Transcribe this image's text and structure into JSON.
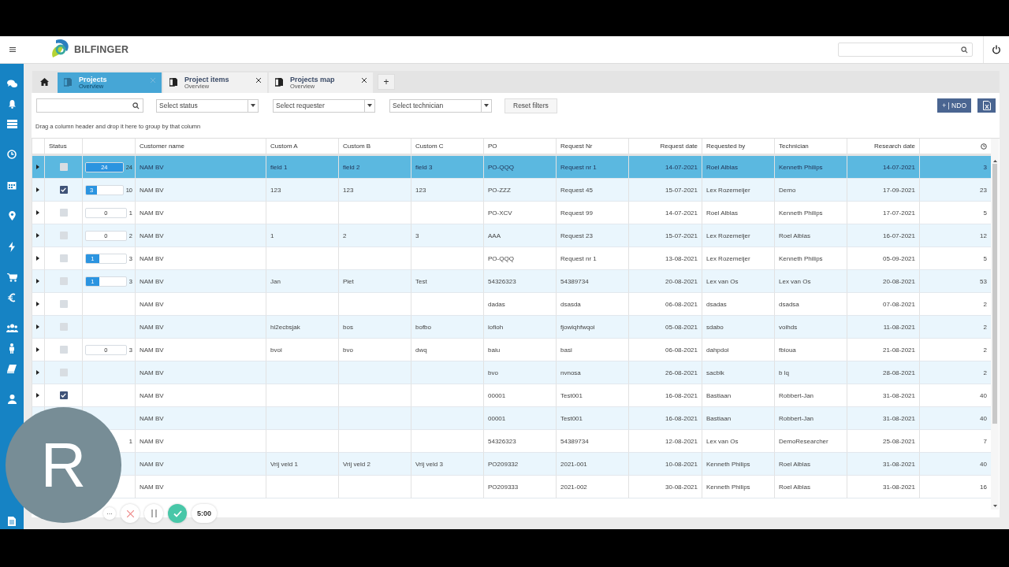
{
  "header": {
    "logo_text": "BILFINGER"
  },
  "tabs": [
    {
      "title": "Projects",
      "subtitle": "Overview",
      "selected": true
    },
    {
      "title": "Project items",
      "subtitle": "Overview",
      "selected": false
    },
    {
      "title": "Projects map",
      "subtitle": "Overview",
      "selected": false
    }
  ],
  "tab_add": "+",
  "filters": {
    "dropdowns": [
      {
        "placeholder": "Select status"
      },
      {
        "placeholder": "Select requester"
      },
      {
        "placeholder": "Select technician"
      }
    ],
    "reset": "Reset filters",
    "new_button": "+ | NDO"
  },
  "group_hint": "Drag a column header and drop it here to group by that column",
  "table": {
    "columns": [
      null,
      "Status",
      null,
      "Customer name",
      "Custom A",
      "Custom B",
      "Custom C",
      "PO",
      "Request Nr",
      "Request date",
      "Requested by",
      "Technician",
      "Research date",
      null
    ],
    "rows": [
      {
        "selected": true,
        "checked": false,
        "progress": {
          "value": "24",
          "total": "24",
          "level": 1
        },
        "cells": [
          null,
          null,
          null,
          "NAM BV",
          "field 1",
          "field 2",
          "field 3",
          "PO-QQQ",
          "Request nr 1",
          "14-07-2021",
          "Roel Alblas",
          "Kenneth Philips",
          "14-07-2021",
          "3"
        ]
      },
      {
        "selected": false,
        "checked": true,
        "progress": {
          "value": "3",
          "total": "10",
          "level": 0.3
        },
        "cells": [
          null,
          null,
          null,
          "NAM BV",
          "123",
          "123",
          "123",
          "PO-ZZZ",
          "Request 45",
          "15-07-2021",
          "Lex Rozemeijer",
          "Demo",
          "17-09-2021",
          "23"
        ]
      },
      {
        "selected": false,
        "checked": false,
        "progress": {
          "value": "0",
          "total": "1",
          "level": 0
        },
        "cells": [
          null,
          null,
          null,
          "NAM BV",
          null,
          null,
          null,
          "PO-XCV",
          "Request 99",
          "14-07-2021",
          "Roel Alblas",
          "Kenneth Philips",
          "17-07-2021",
          "5"
        ]
      },
      {
        "selected": false,
        "checked": false,
        "progress": {
          "value": "0",
          "total": "2",
          "level": 0
        },
        "cells": [
          null,
          null,
          null,
          "NAM BV",
          "1",
          "2",
          "3",
          "AAA",
          "Request 23",
          "15-07-2021",
          "Lex Rozemeijer",
          "Roel Alblas",
          "16-07-2021",
          "12"
        ]
      },
      {
        "selected": false,
        "checked": false,
        "progress": {
          "value": "1",
          "total": "3",
          "level": 0.33
        },
        "cells": [
          null,
          null,
          null,
          "NAM BV",
          null,
          null,
          null,
          "PO-QQQ",
          "Request nr 1",
          "13-08-2021",
          "Lex Rozemeijer",
          "Kenneth Philips",
          "05-09-2021",
          "5"
        ]
      },
      {
        "selected": false,
        "checked": false,
        "progress": {
          "value": "1",
          "total": "3",
          "level": 0.33
        },
        "cells": [
          null,
          null,
          null,
          "NAM BV",
          "Jan",
          "Piet",
          "Test",
          "54326323",
          "54389734",
          "20-08-2021",
          "Lex van Os",
          "Lex van Os",
          "20-08-2021",
          "53"
        ]
      },
      {
        "selected": false,
        "checked": false,
        "cells": [
          null,
          null,
          null,
          "NAM BV",
          null,
          null,
          null,
          "dadas",
          "dsasda",
          "06-08-2021",
          "dsadas",
          "dsadsa",
          "07-08-2021",
          "2"
        ]
      },
      {
        "selected": false,
        "checked": false,
        "cells": [
          null,
          null,
          null,
          "NAM BV",
          "hi2ecbsjak",
          "bos",
          "bofbo",
          "iofioh",
          "fjowiqhfwqoi",
          "05-08-2021",
          "sdabo",
          "voihds",
          "11-08-2021",
          "2"
        ]
      },
      {
        "selected": false,
        "checked": false,
        "progress": {
          "value": "0",
          "total": "3",
          "level": 0
        },
        "cells": [
          null,
          null,
          null,
          "NAM BV",
          "bvoi",
          "bvo",
          "dwq",
          "baiu",
          "basi",
          "06-08-2021",
          "dahpdoi",
          "fbioua",
          "21-08-2021",
          "2"
        ]
      },
      {
        "selected": false,
        "checked": false,
        "cells": [
          null,
          null,
          null,
          "NAM BV",
          null,
          null,
          null,
          "bvo",
          "nvnosa",
          "26-08-2021",
          "sacblk",
          "b lq",
          "28-08-2021",
          "2"
        ]
      },
      {
        "selected": false,
        "checked": true,
        "cells": [
          null,
          null,
          null,
          "NAM BV",
          null,
          null,
          null,
          "00001",
          "Test001",
          "16-08-2021",
          "Bastiaan",
          "Robbert-Jan",
          "31-08-2021",
          "40"
        ]
      },
      {
        "selected": false,
        "cells": [
          null,
          null,
          null,
          "NAM BV",
          null,
          null,
          null,
          "00001",
          "Test001",
          "16-08-2021",
          "Bastiaan",
          "Robbert-Jan",
          "31-08-2021",
          "40"
        ]
      },
      {
        "selected": false,
        "progress": {
          "total": "1"
        },
        "cells": [
          null,
          null,
          null,
          "NAM BV",
          null,
          null,
          null,
          "54326323",
          "54389734",
          "12-08-2021",
          "Lex van Os",
          "DemoResearcher",
          "25-08-2021",
          "7"
        ]
      },
      {
        "selected": false,
        "cells": [
          null,
          null,
          null,
          "NAM BV",
          "Vrij veld 1",
          "Vrij veld 2",
          "Vrij veld 3",
          "PO209332",
          "2021-001",
          "10-08-2021",
          "Kenneth Philips",
          "Roel Alblas",
          "31-08-2021",
          "40"
        ]
      },
      {
        "selected": false,
        "cells": [
          null,
          null,
          null,
          "NAM BV",
          null,
          null,
          null,
          "PO209333",
          "2021-002",
          "30-08-2021",
          "Kenneth Philips",
          "Roel Alblas",
          "31-08-2021",
          "16"
        ]
      }
    ]
  },
  "recorder": {
    "avatar_letter": "R",
    "more": "···",
    "timer": "5:00"
  }
}
